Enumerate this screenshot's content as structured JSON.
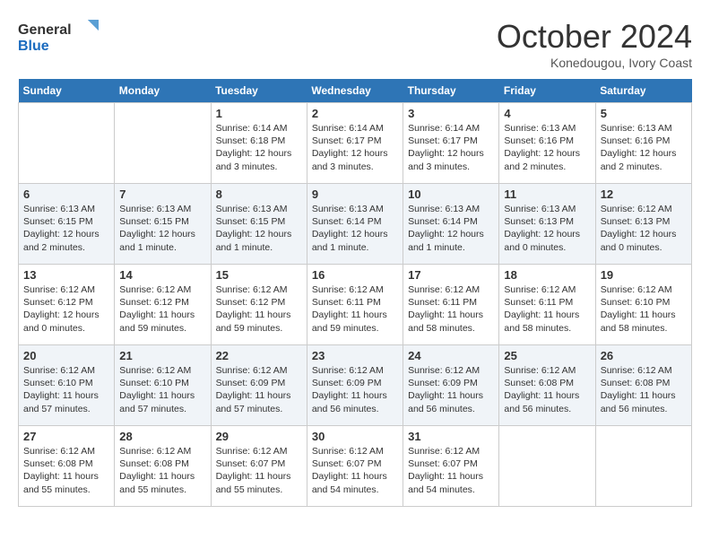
{
  "header": {
    "logo_line1": "General",
    "logo_line2": "Blue",
    "month_title": "October 2024",
    "subtitle": "Konedougou, Ivory Coast"
  },
  "days_of_week": [
    "Sunday",
    "Monday",
    "Tuesday",
    "Wednesday",
    "Thursday",
    "Friday",
    "Saturday"
  ],
  "weeks": [
    [
      {
        "day": "",
        "info": ""
      },
      {
        "day": "",
        "info": ""
      },
      {
        "day": "1",
        "info": "Sunrise: 6:14 AM\nSunset: 6:18 PM\nDaylight: 12 hours and 3 minutes."
      },
      {
        "day": "2",
        "info": "Sunrise: 6:14 AM\nSunset: 6:17 PM\nDaylight: 12 hours and 3 minutes."
      },
      {
        "day": "3",
        "info": "Sunrise: 6:14 AM\nSunset: 6:17 PM\nDaylight: 12 hours and 3 minutes."
      },
      {
        "day": "4",
        "info": "Sunrise: 6:13 AM\nSunset: 6:16 PM\nDaylight: 12 hours and 2 minutes."
      },
      {
        "day": "5",
        "info": "Sunrise: 6:13 AM\nSunset: 6:16 PM\nDaylight: 12 hours and 2 minutes."
      }
    ],
    [
      {
        "day": "6",
        "info": "Sunrise: 6:13 AM\nSunset: 6:15 PM\nDaylight: 12 hours and 2 minutes."
      },
      {
        "day": "7",
        "info": "Sunrise: 6:13 AM\nSunset: 6:15 PM\nDaylight: 12 hours and 1 minute."
      },
      {
        "day": "8",
        "info": "Sunrise: 6:13 AM\nSunset: 6:15 PM\nDaylight: 12 hours and 1 minute."
      },
      {
        "day": "9",
        "info": "Sunrise: 6:13 AM\nSunset: 6:14 PM\nDaylight: 12 hours and 1 minute."
      },
      {
        "day": "10",
        "info": "Sunrise: 6:13 AM\nSunset: 6:14 PM\nDaylight: 12 hours and 1 minute."
      },
      {
        "day": "11",
        "info": "Sunrise: 6:13 AM\nSunset: 6:13 PM\nDaylight: 12 hours and 0 minutes."
      },
      {
        "day": "12",
        "info": "Sunrise: 6:12 AM\nSunset: 6:13 PM\nDaylight: 12 hours and 0 minutes."
      }
    ],
    [
      {
        "day": "13",
        "info": "Sunrise: 6:12 AM\nSunset: 6:12 PM\nDaylight: 12 hours and 0 minutes."
      },
      {
        "day": "14",
        "info": "Sunrise: 6:12 AM\nSunset: 6:12 PM\nDaylight: 11 hours and 59 minutes."
      },
      {
        "day": "15",
        "info": "Sunrise: 6:12 AM\nSunset: 6:12 PM\nDaylight: 11 hours and 59 minutes."
      },
      {
        "day": "16",
        "info": "Sunrise: 6:12 AM\nSunset: 6:11 PM\nDaylight: 11 hours and 59 minutes."
      },
      {
        "day": "17",
        "info": "Sunrise: 6:12 AM\nSunset: 6:11 PM\nDaylight: 11 hours and 58 minutes."
      },
      {
        "day": "18",
        "info": "Sunrise: 6:12 AM\nSunset: 6:11 PM\nDaylight: 11 hours and 58 minutes."
      },
      {
        "day": "19",
        "info": "Sunrise: 6:12 AM\nSunset: 6:10 PM\nDaylight: 11 hours and 58 minutes."
      }
    ],
    [
      {
        "day": "20",
        "info": "Sunrise: 6:12 AM\nSunset: 6:10 PM\nDaylight: 11 hours and 57 minutes."
      },
      {
        "day": "21",
        "info": "Sunrise: 6:12 AM\nSunset: 6:10 PM\nDaylight: 11 hours and 57 minutes."
      },
      {
        "day": "22",
        "info": "Sunrise: 6:12 AM\nSunset: 6:09 PM\nDaylight: 11 hours and 57 minutes."
      },
      {
        "day": "23",
        "info": "Sunrise: 6:12 AM\nSunset: 6:09 PM\nDaylight: 11 hours and 56 minutes."
      },
      {
        "day": "24",
        "info": "Sunrise: 6:12 AM\nSunset: 6:09 PM\nDaylight: 11 hours and 56 minutes."
      },
      {
        "day": "25",
        "info": "Sunrise: 6:12 AM\nSunset: 6:08 PM\nDaylight: 11 hours and 56 minutes."
      },
      {
        "day": "26",
        "info": "Sunrise: 6:12 AM\nSunset: 6:08 PM\nDaylight: 11 hours and 56 minutes."
      }
    ],
    [
      {
        "day": "27",
        "info": "Sunrise: 6:12 AM\nSunset: 6:08 PM\nDaylight: 11 hours and 55 minutes."
      },
      {
        "day": "28",
        "info": "Sunrise: 6:12 AM\nSunset: 6:08 PM\nDaylight: 11 hours and 55 minutes."
      },
      {
        "day": "29",
        "info": "Sunrise: 6:12 AM\nSunset: 6:07 PM\nDaylight: 11 hours and 55 minutes."
      },
      {
        "day": "30",
        "info": "Sunrise: 6:12 AM\nSunset: 6:07 PM\nDaylight: 11 hours and 54 minutes."
      },
      {
        "day": "31",
        "info": "Sunrise: 6:12 AM\nSunset: 6:07 PM\nDaylight: 11 hours and 54 minutes."
      },
      {
        "day": "",
        "info": ""
      },
      {
        "day": "",
        "info": ""
      }
    ]
  ]
}
